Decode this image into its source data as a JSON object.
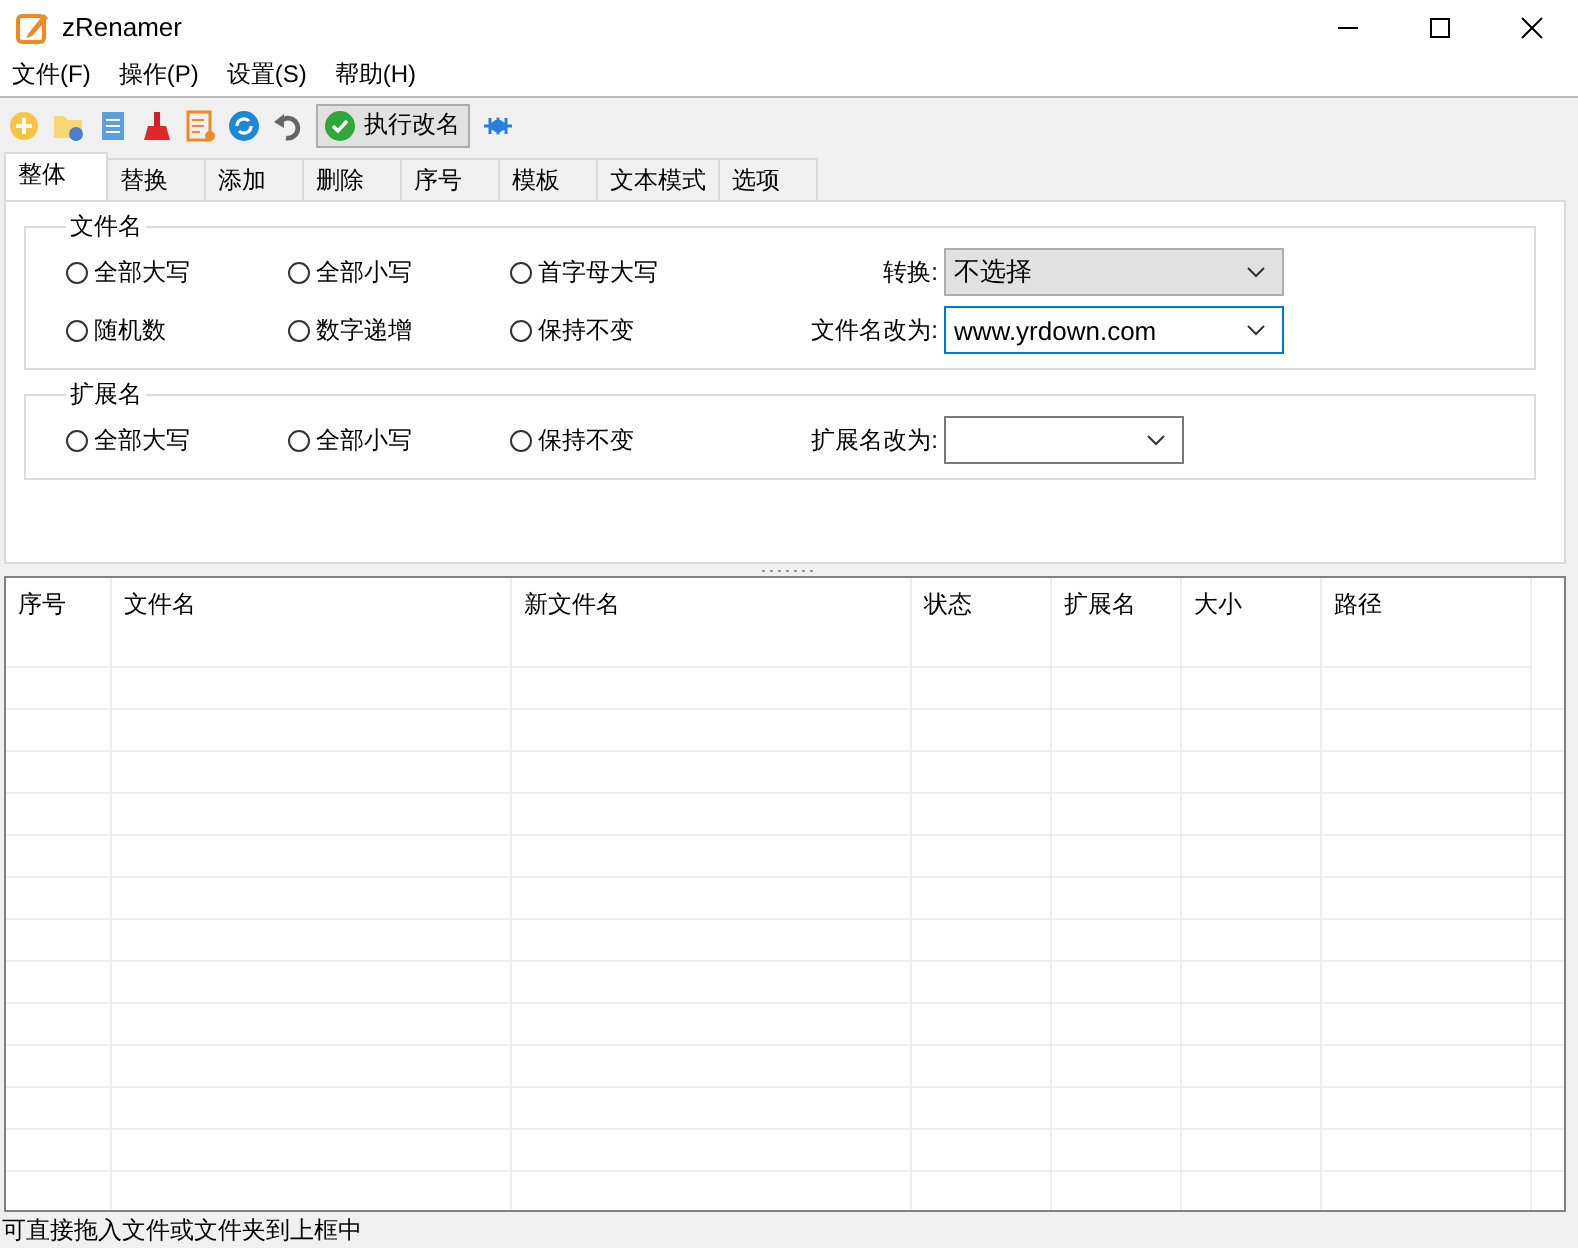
{
  "window": {
    "title": "zRenamer"
  },
  "menu": [
    "文件(F)",
    "操作(P)",
    "设置(S)",
    "帮助(H)"
  ],
  "toolbar": {
    "run_button": "执行改名"
  },
  "tabs": [
    {
      "label": "整体",
      "selected": true
    },
    {
      "label": "替换",
      "selected": false
    },
    {
      "label": "添加",
      "selected": false
    },
    {
      "label": "删除",
      "selected": false
    },
    {
      "label": "序号",
      "selected": false
    },
    {
      "label": "模板",
      "selected": false
    },
    {
      "label": "文本模式",
      "selected": false
    },
    {
      "label": "选项",
      "selected": false
    }
  ],
  "filename_group": {
    "title": "文件名",
    "rows": [
      {
        "options": [
          {
            "label": "全部大写",
            "selected": false
          },
          {
            "label": "全部小写",
            "selected": false
          },
          {
            "label": "首字母大写",
            "selected": false
          }
        ],
        "field_label": "转换:",
        "field_value": "不选择",
        "kind": "select"
      },
      {
        "options": [
          {
            "label": "随机数",
            "selected": false
          },
          {
            "label": "数字递增",
            "selected": false
          },
          {
            "label": "保持不变",
            "selected": false
          }
        ],
        "field_label": "文件名改为:",
        "field_value": "www.yrdown.com",
        "kind": "combo"
      }
    ]
  },
  "extension_group": {
    "title": "扩展名",
    "rows": [
      {
        "options": [
          {
            "label": "全部大写",
            "selected": false
          },
          {
            "label": "全部小写",
            "selected": false
          },
          {
            "label": "保持不变",
            "selected": false
          }
        ],
        "field_label": "扩展名改为:",
        "kind": "combo-small"
      }
    ]
  },
  "table": {
    "columns": [
      "序号",
      "文件名",
      "新文件名",
      "状态",
      "扩展名",
      "大小",
      "路径"
    ]
  },
  "status_bar": "可直接拖入文件或文件夹到上框中"
}
